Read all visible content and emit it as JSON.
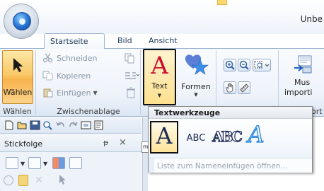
{
  "window": {
    "title": "Unbe",
    "title_marker": ""
  },
  "tabs": [
    {
      "label": "Startseite",
      "active": true
    },
    {
      "label": "Bild",
      "active": false
    },
    {
      "label": "Ansicht",
      "active": false
    }
  ],
  "ribbon": {
    "waehlen_button": "Wählen",
    "waehlen_group": "Wählen",
    "clipboard": {
      "cut": "Schneiden",
      "copy": "Kopieren",
      "paste": "Einfügen",
      "group": "Zwischenablage"
    },
    "text_button": {
      "glyph": "A",
      "label": "Text"
    },
    "shapes_button": {
      "label": "Formen"
    },
    "import_button": {
      "line1": "Mus",
      "line2": "importi"
    },
    "partial_group": "ort"
  },
  "text_tools_popup": {
    "title": "Textwerkzeuge",
    "items": [
      {
        "name": "text-tool",
        "glyph": "A"
      },
      {
        "name": "small-text-tool",
        "glyph": "ABC"
      },
      {
        "name": "monogram-tool",
        "glyph": "ABC"
      },
      {
        "name": "script-text-tool",
        "glyph": "A"
      }
    ],
    "name_list": "Liste zum Nameneinfügen öffnen..."
  },
  "panel": {
    "title": "Stickfolge",
    "pin": "ᵽ",
    "close": "×"
  },
  "ruler": {
    "unit": "mm"
  },
  "colors": {
    "selected_orange": "#f7b24c",
    "text_red": "#c8102e",
    "accent_blue": "#2a78d8"
  }
}
